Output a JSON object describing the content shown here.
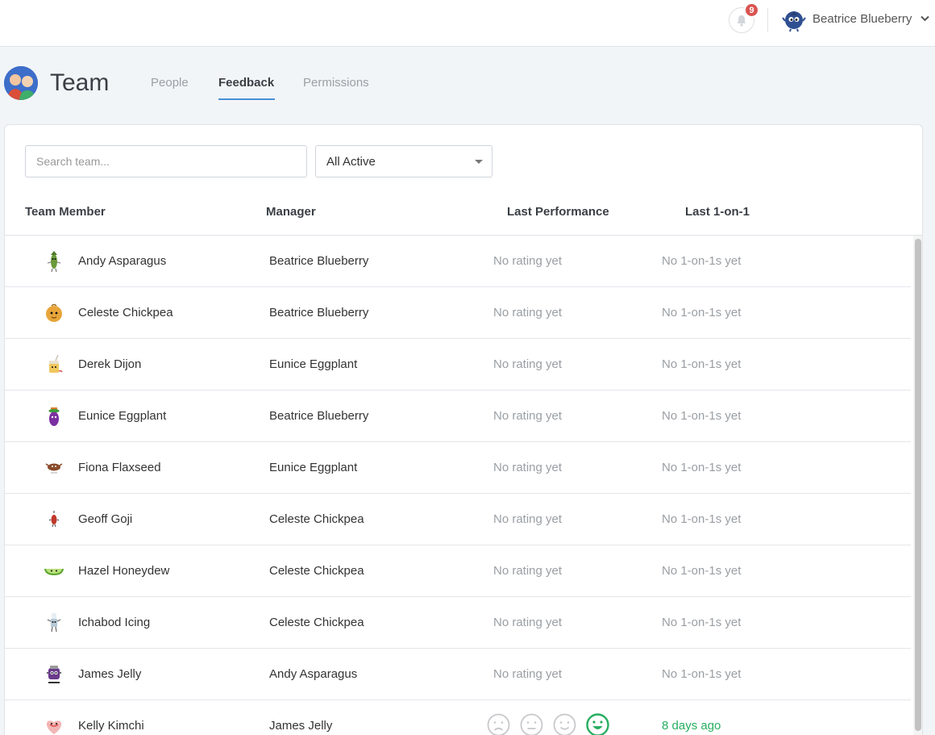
{
  "topbar": {
    "notifications_count": "9",
    "user_name": "Beatrice Blueberry"
  },
  "header": {
    "title": "Team",
    "tabs": [
      {
        "label": "People",
        "active": false
      },
      {
        "label": "Feedback",
        "active": true
      },
      {
        "label": "Permissions",
        "active": false
      }
    ]
  },
  "filters": {
    "search_placeholder": "Search team...",
    "status_selected": "All Active"
  },
  "table": {
    "columns": [
      "Team Member",
      "Manager",
      "Last Performance",
      "Last 1-on-1"
    ],
    "rows": [
      {
        "member": "Andy Asparagus",
        "manager": "Beatrice Blueberry",
        "performance": "No rating yet",
        "one_on_one": "No 1-on-1s yet",
        "avatar": "asparagus-avatar"
      },
      {
        "member": "Celeste Chickpea",
        "manager": "Beatrice Blueberry",
        "performance": "No rating yet",
        "one_on_one": "No 1-on-1s yet",
        "avatar": "chickpea-avatar"
      },
      {
        "member": "Derek Dijon",
        "manager": "Eunice Eggplant",
        "performance": "No rating yet",
        "one_on_one": "No 1-on-1s yet",
        "avatar": "dijon-avatar"
      },
      {
        "member": "Eunice Eggplant",
        "manager": "Beatrice Blueberry",
        "performance": "No rating yet",
        "one_on_one": "No 1-on-1s yet",
        "avatar": "eggplant-avatar"
      },
      {
        "member": "Fiona Flaxseed",
        "manager": "Eunice Eggplant",
        "performance": "No rating yet",
        "one_on_one": "No 1-on-1s yet",
        "avatar": "flaxseed-avatar"
      },
      {
        "member": "Geoff Goji",
        "manager": "Celeste Chickpea",
        "performance": "No rating yet",
        "one_on_one": "No 1-on-1s yet",
        "avatar": "goji-avatar"
      },
      {
        "member": "Hazel Honeydew",
        "manager": "Celeste Chickpea",
        "performance": "No rating yet",
        "one_on_one": "No 1-on-1s yet",
        "avatar": "honeydew-avatar"
      },
      {
        "member": "Ichabod Icing",
        "manager": "Celeste Chickpea",
        "performance": "No rating yet",
        "one_on_one": "No 1-on-1s yet",
        "avatar": "icing-avatar"
      },
      {
        "member": "James Jelly",
        "manager": "Andy Asparagus",
        "performance": "No rating yet",
        "one_on_one": "No 1-on-1s yet",
        "avatar": "jelly-avatar"
      },
      {
        "member": "Kelly Kimchi",
        "manager": "James Jelly",
        "performance_faces": [
          "sad-face-icon",
          "neutral-face-icon",
          "smile-face-icon",
          "happy-face-icon"
        ],
        "performance_selected": 4,
        "one_on_one": "8 days ago",
        "avatar": "kimchi-avatar"
      }
    ]
  },
  "colors": {
    "accent": "#4a90d9",
    "badge": "#d9534f",
    "positive": "#27ae60"
  }
}
